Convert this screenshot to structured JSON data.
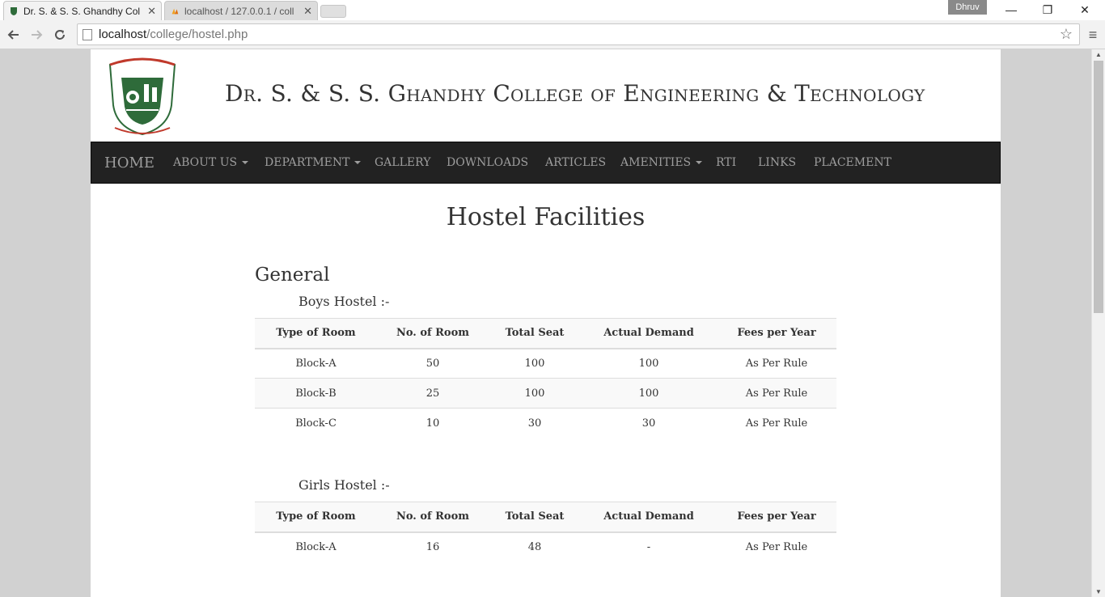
{
  "browser": {
    "tabs": [
      {
        "title": "Dr. S. & S. S. Ghandhy Col",
        "active": true
      },
      {
        "title": "localhost / 127.0.0.1 / coll",
        "active": false
      }
    ],
    "profile_name": "Dhruv",
    "url_host": "localhost",
    "url_path": "/college/hostel.php",
    "window_buttons": {
      "minimize": "—",
      "restore": "❐",
      "close": "✕"
    }
  },
  "site": {
    "college_name": "Dr. S. & S. S. Ghandhy College of Engineering & Technology",
    "nav": {
      "home": "HOME",
      "about": "ABOUT US",
      "department": "DEPARTMENT",
      "gallery": "GALLERY",
      "downloads": "DOWNLOADS",
      "articles": "ARTICLES",
      "amenities": "AMENITIES",
      "rti": "RTI",
      "links": "LINKS",
      "placement": "PLACEMENT"
    }
  },
  "page": {
    "title": "Hostel Facilities",
    "section": "General",
    "boys": {
      "title": "Boys Hostel :-",
      "headers": [
        "Type of Room",
        "No. of Room",
        "Total Seat",
        "Actual Demand",
        "Fees per Year"
      ],
      "rows": [
        [
          "Block-A",
          "50",
          "100",
          "100",
          "As Per Rule"
        ],
        [
          "Block-B",
          "25",
          "100",
          "100",
          "As Per Rule"
        ],
        [
          "Block-C",
          "10",
          "30",
          "30",
          "As Per Rule"
        ]
      ]
    },
    "girls": {
      "title": "Girls Hostel :-",
      "headers": [
        "Type of Room",
        "No. of Room",
        "Total Seat",
        "Actual Demand",
        "Fees per Year"
      ],
      "rows": [
        [
          "Block-A",
          "16",
          "48",
          "-",
          "As Per Rule"
        ]
      ]
    }
  },
  "colors": {
    "navbar": "#222222",
    "nav_text": "#9d9d9d",
    "page_bg": "#d1d1d1",
    "logo_green": "#2e6b3a",
    "logo_red": "#c0392b"
  }
}
